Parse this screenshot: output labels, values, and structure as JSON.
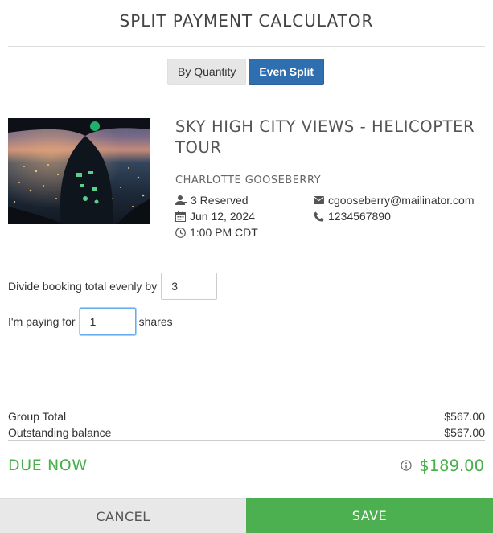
{
  "header": {
    "title": "SPLIT PAYMENT CALCULATOR"
  },
  "tabs": [
    {
      "label": "By Quantity",
      "active": false
    },
    {
      "label": "Even Split",
      "active": true
    }
  ],
  "booking": {
    "tour_title": "SKY HIGH CITY VIEWS - HELICOPTER TOUR",
    "customer_name": "CHARLOTTE GOOSEBERRY",
    "reserved": "3 Reserved",
    "date": "Jun 12, 2024",
    "time": "1:00 PM CDT",
    "email": "cgooseberry@mailinator.com",
    "phone": "1234567890"
  },
  "split": {
    "divide_label": "Divide booking total evenly by",
    "divide_value": "3",
    "paying_label": "I'm paying for",
    "paying_value": "1",
    "shares_label": "shares"
  },
  "summary": {
    "group_total_label": "Group Total",
    "group_total_value": "$567.00",
    "outstanding_label": "Outstanding balance",
    "outstanding_value": "$567.00",
    "due_label": "DUE NOW",
    "due_value": "$189.00"
  },
  "footer": {
    "cancel_label": "CANCEL",
    "save_label": "SAVE"
  },
  "colors": {
    "accent_blue": "#2f6fb0",
    "accent_green": "#47b04b",
    "save_green": "#4caf50"
  },
  "icons": [
    "user-icon",
    "calendar-icon",
    "clock-icon",
    "envelope-icon",
    "phone-icon",
    "info-icon"
  ]
}
